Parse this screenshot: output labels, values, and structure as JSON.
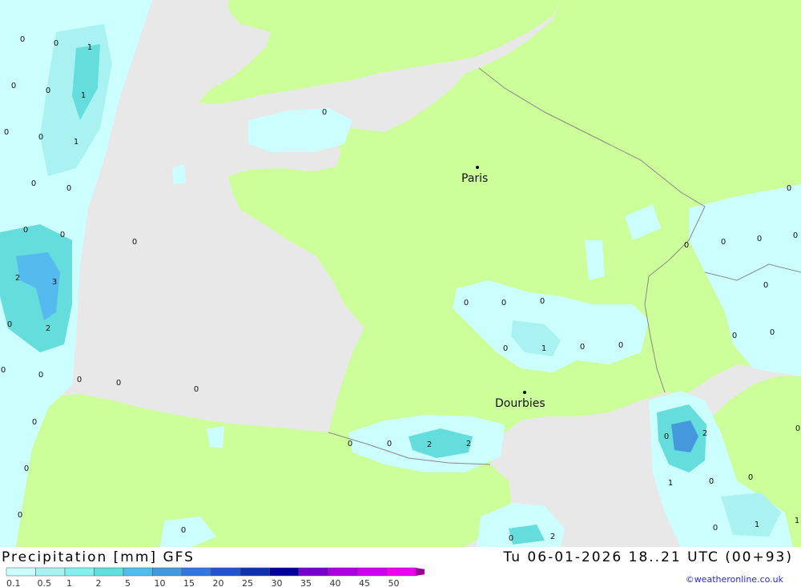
{
  "title": "Precipitation [mm] GFS",
  "datetime": "Tu 06-01-2026 18..21 UTC (00+93)",
  "credit": "©weatheronline.co.uk",
  "colors": {
    "sea": "#e8e8e8",
    "land": "#ccff99",
    "border": "#888888",
    "scale": [
      "#ccffff",
      "#aaf2f2",
      "#88eeee",
      "#66dddd",
      "#55bbee",
      "#4499dd",
      "#3377dd",
      "#2255cc",
      "#1133aa",
      "#000099",
      "#7700cc",
      "#aa00dd",
      "#cc00ee",
      "#ee00ee",
      "#cc00cc",
      "#990099"
    ]
  },
  "legend": {
    "labels": [
      "0.1",
      "0.5",
      "1",
      "2",
      "5",
      "10",
      "15",
      "20",
      "25",
      "30",
      "35",
      "40",
      "45",
      "50"
    ]
  },
  "cities": [
    {
      "name": "Paris"
    },
    {
      "name": "Dourbies"
    }
  ],
  "values": [
    "0",
    "0",
    "1",
    "0",
    "0",
    "1",
    "0",
    "0",
    "1",
    "0",
    "0",
    "0",
    "0",
    "0",
    "2",
    "3",
    "0",
    "2",
    "0",
    "0",
    "0",
    "0",
    "0",
    "0",
    "0",
    "0",
    "0",
    "0",
    "0",
    "0",
    "0",
    "1",
    "0",
    "0",
    "0",
    "0",
    "2",
    "2",
    "0",
    "0",
    "0",
    "0",
    "0",
    "0",
    "0",
    "0",
    "0",
    "2",
    "1",
    "0",
    "0",
    "0",
    "1",
    "1",
    "0",
    "2",
    "0",
    "0"
  ]
}
